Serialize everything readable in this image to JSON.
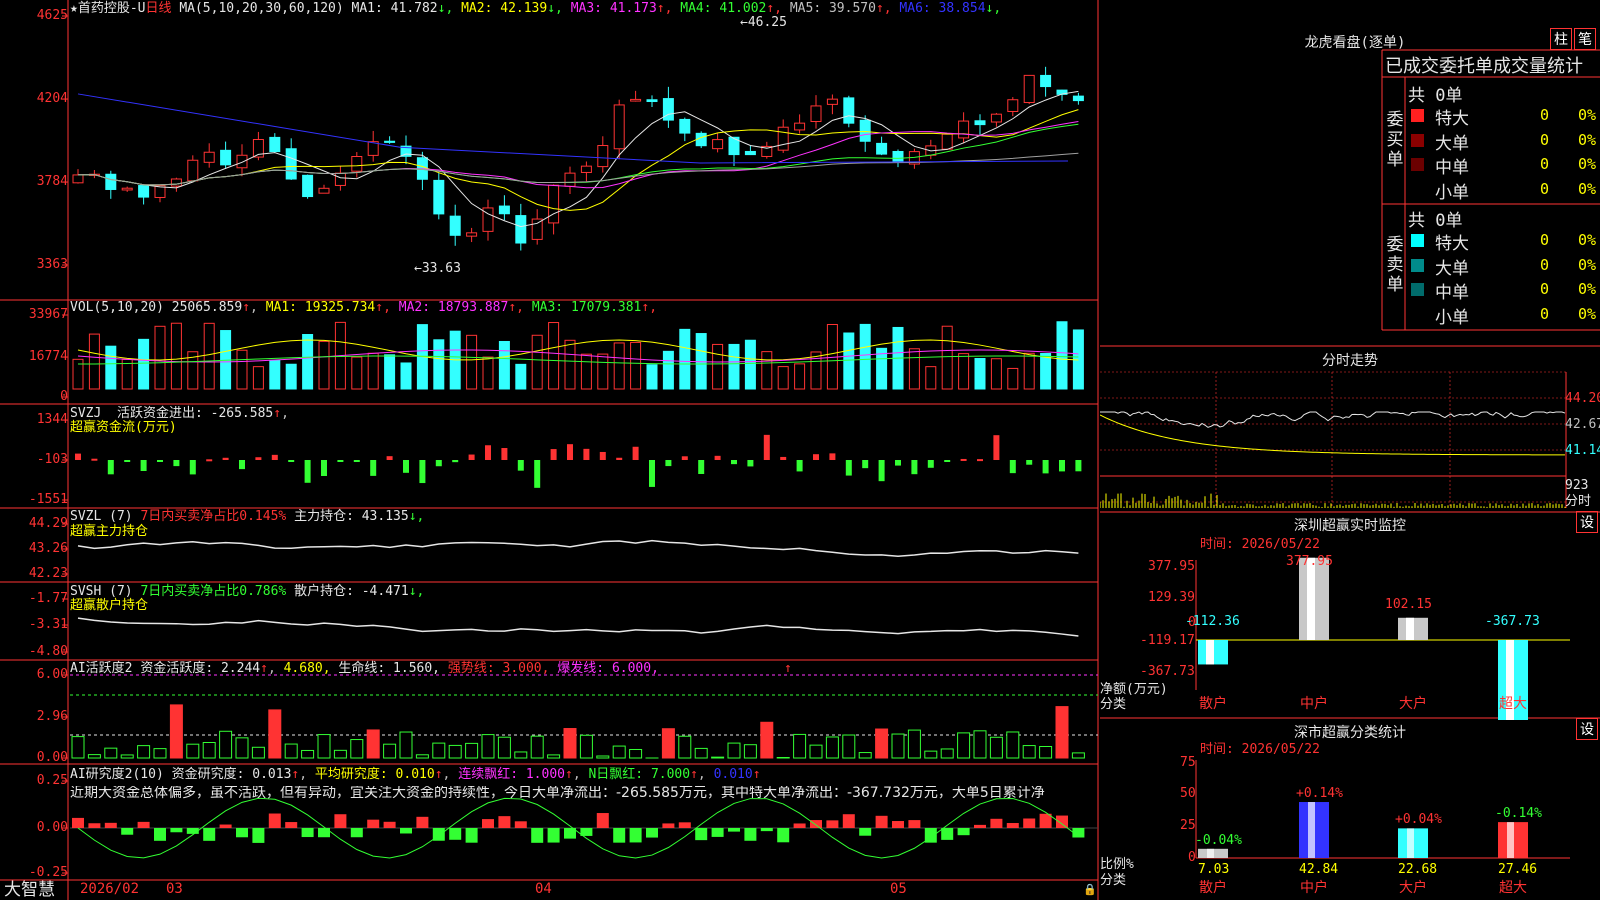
{
  "main": {
    "title": "★首药控股-U",
    "period": "日线",
    "ma_label": "MA(5,10,20,30,60,120)",
    "ma": [
      {
        "label": "MA1:",
        "value": "41.782",
        "arrow": "↓",
        "color": "#e6e6e6"
      },
      {
        "label": "MA2:",
        "value": "42.139",
        "arrow": "↓",
        "color": "#ffff00"
      },
      {
        "label": "MA3:",
        "value": "41.173",
        "arrow": "↑",
        "color": "#ff33ff"
      },
      {
        "label": "MA4:",
        "value": "41.002",
        "arrow": "↑",
        "color": "#33ff33"
      },
      {
        "label": "MA5:",
        "value": "39.570",
        "arrow": "↑",
        "color": "#c0c0c0"
      },
      {
        "label": "MA6:",
        "value": "38.854",
        "arrow": "↓",
        "color": "#3333ff"
      }
    ],
    "axis": [
      "4625",
      "4204",
      "3784",
      "3363"
    ],
    "high_marker": "46.25",
    "low_marker": "33.63"
  },
  "vol": {
    "label": "VOL(5,10,20)",
    "value": "25065.859",
    "ma": [
      {
        "label": "MA1:",
        "value": "19325.734",
        "arrow": "↑",
        "color": "#ffff00"
      },
      {
        "label": "MA2:",
        "value": "18793.887",
        "arrow": "↑",
        "color": "#ff33ff"
      },
      {
        "label": "MA3:",
        "value": "17079.381",
        "arrow": "↑",
        "color": "#33ff33"
      }
    ],
    "axis": [
      "33967",
      "16774",
      "0"
    ]
  },
  "svzj": {
    "label": "SVZJ",
    "text": "活跃资金进出:",
    "value": "-265.585",
    "arrow": "↑",
    "sub": "超赢资金流(万元)",
    "axis": [
      "1344",
      "-103",
      "-1551"
    ]
  },
  "svzl": {
    "label": "SVZL (7)",
    "ratio": "7日内买卖净占比0.145%",
    "hold": "主力持仓: 43.135",
    "arrow": "↓,",
    "sub": "超赢主力持仓",
    "axis": [
      "44.29",
      "43.26",
      "42.23"
    ]
  },
  "svsh": {
    "label": "SVSH (7)",
    "ratio": "7日内买卖净占比0.786%",
    "hold": "散户持仓: -4.471",
    "arrow": "↓,",
    "sub": "超赢散户持仓",
    "axis": [
      "-1.77",
      "-3.31",
      "-4.80"
    ]
  },
  "ai1": {
    "label": "AI活跃度2",
    "text": "资金活跃度: 2.244",
    "v2": "4.680,",
    "life": "生命线: 1.560,",
    "strong": "强势线: 3.000,",
    "burst": "爆发线: 6.000,",
    "axis": [
      "6.00",
      "2.96",
      "0.00"
    ]
  },
  "ai2": {
    "label": "AI研究度2(10)",
    "text": "资金研究度: 0.013",
    "avg": "平均研究度: 0.010",
    "streak": "连续飘红: 1.000",
    "nred": "N日飘红: 7.000",
    "last": "0.010",
    "comment": "近期大资金总体偏多，虽不活跃，但有异动，宜关注大资金的持续性，今日大单净流出：-265.585万元，其中特大单净流出：-367.732万元，大单5日累计净",
    "axis": [
      "0.25",
      "0.00",
      "-0.25"
    ]
  },
  "footer": {
    "brand": "大智慧",
    "dates": [
      "2026/02",
      "03",
      "04",
      "05"
    ]
  },
  "lhb": {
    "title": "龙虎看盘(逐单)",
    "btn1": "柱",
    "btn2": "笔",
    "tabs": "已成交委托单成交量统计",
    "buy_label": "委买单",
    "sell_label": "委卖单",
    "buy_total": "共 0单",
    "sell_total": "共 0单",
    "buy_rows": [
      {
        "name": "特大",
        "count": "0",
        "pct": "0%",
        "color": "#ff2020"
      },
      {
        "name": "大单",
        "count": "0",
        "pct": "0%",
        "color": "#8b0000"
      },
      {
        "name": "中单",
        "count": "0",
        "pct": "0%",
        "color": "#6b0000"
      },
      {
        "name": "小单",
        "count": "0",
        "pct": "0%",
        "color": ""
      }
    ],
    "sell_rows": [
      {
        "name": "特大",
        "count": "0",
        "pct": "0%",
        "color": "#00ffff"
      },
      {
        "name": "大单",
        "count": "0",
        "pct": "0%",
        "color": "#008b8b"
      },
      {
        "name": "中单",
        "count": "0",
        "pct": "0%",
        "color": "#006b6b"
      },
      {
        "name": "小单",
        "count": "0",
        "pct": "0%",
        "color": ""
      }
    ]
  },
  "fenshi": {
    "title": "分时走势",
    "axis": [
      "44.20",
      "42.67",
      "41.14",
      "923",
      "分时"
    ]
  },
  "szmon": {
    "title": "深圳超赢实时监控",
    "btn": "设",
    "time": "时间: 2026/05/22",
    "axis": [
      "377.95",
      "129.39",
      "0",
      "-119.17",
      "-367.73"
    ],
    "ylabel": "净额(万元)",
    "xlabel": "分类",
    "cats": [
      "散户",
      "中户",
      "大户",
      "超大"
    ],
    "values": [
      "-112.36",
      "377.95",
      "102.15",
      "-367.73"
    ]
  },
  "szcls": {
    "title": "深市超赢分类统计",
    "btn": "设",
    "time": "时间: 2026/05/22",
    "axis": [
      "75",
      "50",
      "25",
      "0"
    ],
    "ylabel": "比例%",
    "xlabel": "分类",
    "cats": [
      "散户",
      "中户",
      "大户",
      "超大"
    ],
    "pcts": [
      "7.03",
      "42.84",
      "22.68",
      "27.46"
    ],
    "changes": [
      "-0.04%",
      "+0.14%",
      "+0.04%",
      "-0.14%"
    ]
  }
}
